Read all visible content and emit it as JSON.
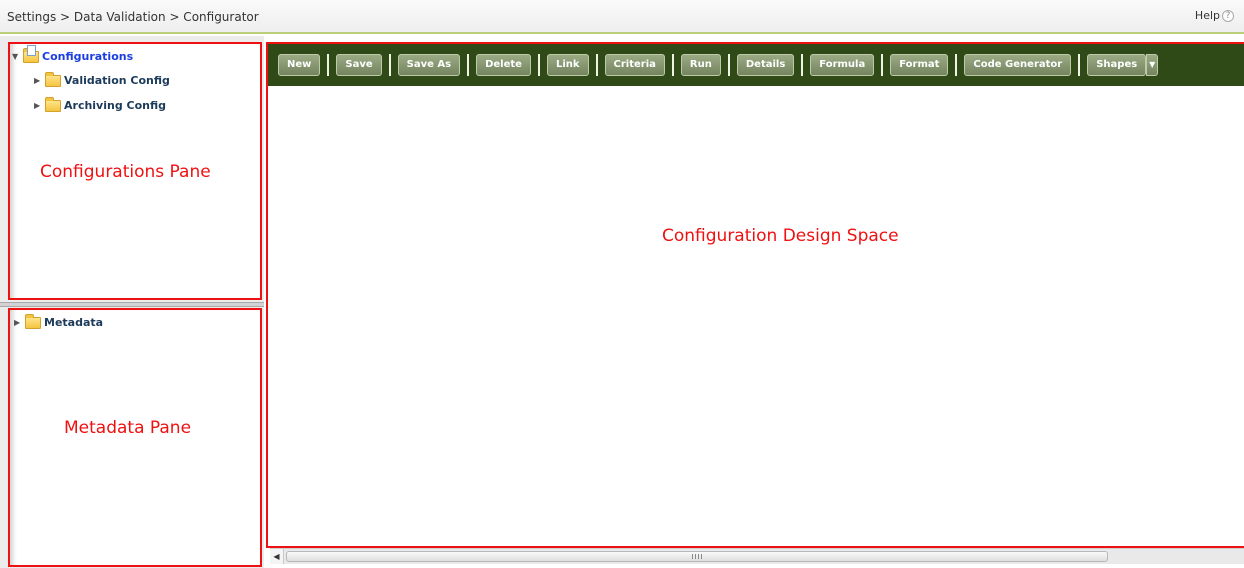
{
  "header": {
    "breadcrumb": "Settings > Data Validation > Configurator",
    "help_label": "Help",
    "help_icon_glyph": "?"
  },
  "config_tree": {
    "root": {
      "label": "Configurations",
      "expanded": true,
      "icon": "folder-document-icon"
    },
    "children": [
      {
        "label": "Validation Config",
        "icon": "folder-icon"
      },
      {
        "label": "Archiving Config",
        "icon": "folder-icon"
      }
    ]
  },
  "metadata_tree": {
    "root": {
      "label": "Metadata",
      "icon": "folder-icon"
    }
  },
  "toolbar": {
    "buttons": [
      "New",
      "Save",
      "Save As",
      "Delete",
      "Link",
      "Criteria",
      "Run",
      "Details",
      "Formula",
      "Format",
      "Code Generator",
      "Shapes"
    ]
  },
  "annotations": {
    "config_pane": "Configurations Pane",
    "metadata_pane": "Metadata Pane",
    "design_space": "Configuration Design Space"
  },
  "colors": {
    "annotation": "#ee1111",
    "toolbar_bg": "#2f4a17",
    "button": "#83946d",
    "link": "#1a3ee0"
  }
}
